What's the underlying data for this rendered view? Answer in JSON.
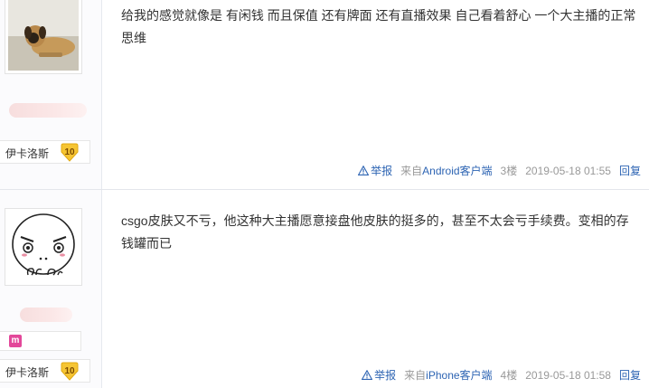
{
  "posts": [
    {
      "username": "伊卡洛斯",
      "level": "10",
      "avatar_icon": "dog-photo",
      "content": "给我的感觉就像是 有闲钱 而且保值 还有牌面 还有直播效果 自己看着舒心 一个大主播的正常思维",
      "report_label": "举报",
      "from_prefix": "来自",
      "device": "Android客户端",
      "floor": "3楼",
      "time": "2019-05-18 01:55",
      "reply_label": "回复"
    },
    {
      "username": "伊卡洛斯",
      "level": "10",
      "avatar_icon": "cartoon-face",
      "badge_icon": "m-badge-icon",
      "content": "csgo皮肤又不亏，他这种大主播愿意接盘他皮肤的挺多的，甚至不太会亏手续费。变相的存钱罐而已",
      "report_label": "举报",
      "from_prefix": "来自",
      "device": "iPhone客户端",
      "floor": "4楼",
      "time": "2019-05-18 01:58",
      "reply_label": "回复"
    }
  ],
  "colors": {
    "link": "#2d64b3",
    "meta": "#999999",
    "level_badge": "#f6c533"
  }
}
